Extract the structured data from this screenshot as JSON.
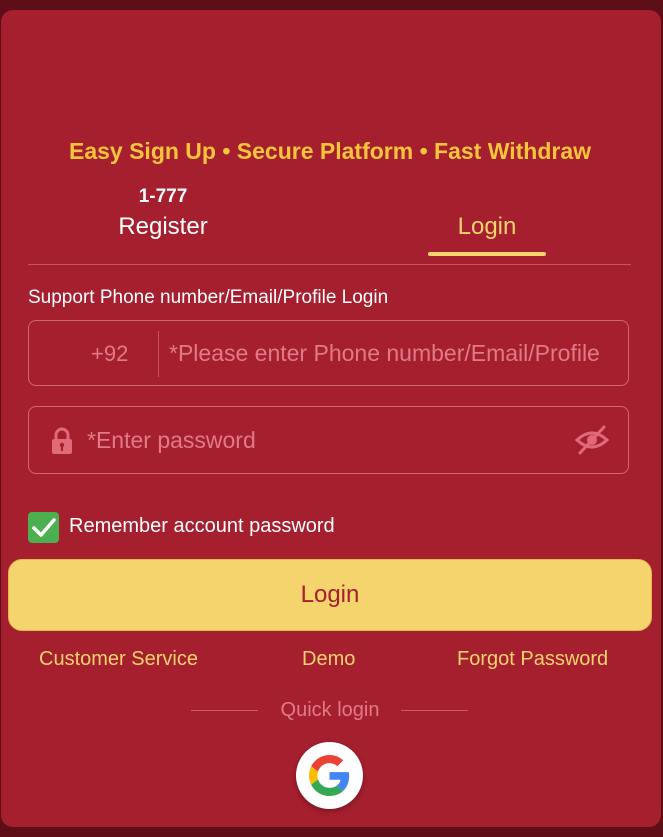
{
  "tagline": "Easy Sign Up • Secure Platform • Fast Withdraw",
  "tabs": {
    "register": {
      "count": "1-777",
      "label": "Register"
    },
    "login": {
      "label": "Login"
    }
  },
  "form": {
    "support_label": "Support Phone number/Email/Profile Login",
    "country_code": "+92",
    "phone_placeholder": "*Please enter Phone number/Email/Profile",
    "password_placeholder": "*Enter password",
    "remember_label": "Remember account password",
    "remember_checked": true,
    "login_button": "Login"
  },
  "links": {
    "customer_service": "Customer Service",
    "demo": "Demo",
    "forgot_password": "Forgot Password"
  },
  "quick_login": {
    "label": "Quick login",
    "provider_icon": "google-icon"
  },
  "colors": {
    "card_background": "#a61f2f",
    "accent_yellow": "#f5d36d",
    "tagline_yellow": "#f7c53c",
    "checkbox_green": "#4caf50"
  }
}
